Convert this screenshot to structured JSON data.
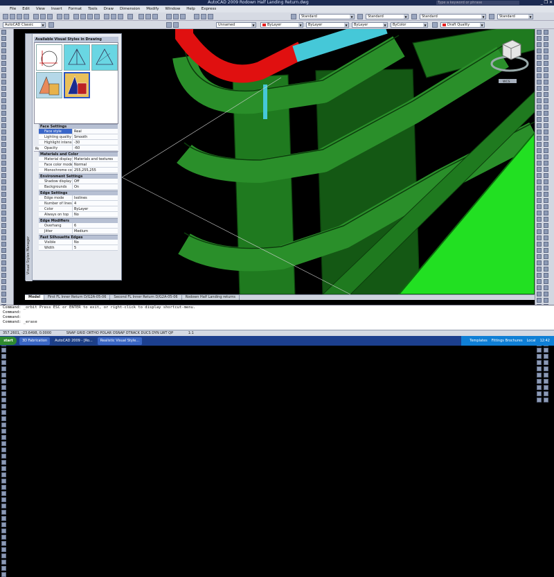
{
  "window": {
    "title": "AutoCAD 2009  Rodown Half Landing Return.dwg",
    "search_placeholder": "Type a keyword or phrase",
    "controls": "_ ❐ ✕"
  },
  "menu": [
    "File",
    "Edit",
    "View",
    "Insert",
    "Format",
    "Tools",
    "Draw",
    "Dimension",
    "Modify",
    "Window",
    "Help",
    "Express"
  ],
  "toolbar1": {
    "textstyle": "Standard",
    "dimstyle": "Standard",
    "tablestyle": "Standard",
    "mleaderstyle": "Standard"
  },
  "toolbar2": {
    "workspace": "AutoCAD Classic",
    "layer": "Unnamed",
    "color": "ByLayer",
    "linetype": "ByLayer",
    "lineweight": "ByLayer",
    "plotstyle": "ByColor",
    "render": "Draft Quality",
    "colors": {
      "layer_red": "#e62020"
    }
  },
  "viewcube": {
    "label": "WCS"
  },
  "visual_styles": {
    "header": "Available Visual Styles in Drawing",
    "current": "Realistic",
    "side_label": "Visual Styles Manager",
    "sections": [
      {
        "title": "Face Settings",
        "rows": [
          {
            "k": "Face style",
            "v": "Real",
            "selected": true
          },
          {
            "k": "Lighting quality",
            "v": "Smooth"
          },
          {
            "k": "Highlight intensity",
            "v": "-30"
          },
          {
            "k": "Opacity",
            "v": "-60"
          }
        ]
      },
      {
        "title": "Materials and Color",
        "rows": [
          {
            "k": "Material display",
            "v": "Materials and textures"
          },
          {
            "k": "Face color mode",
            "v": "Normal"
          },
          {
            "k": "Monochrome color",
            "v": "255,255,255"
          }
        ]
      },
      {
        "title": "Environment Settings",
        "rows": [
          {
            "k": "Shadow display",
            "v": "Off"
          },
          {
            "k": "Backgrounds",
            "v": "On"
          }
        ]
      },
      {
        "title": "Edge Settings",
        "rows": [
          {
            "k": "Edge mode",
            "v": "Isolines"
          },
          {
            "k": "Number of lines",
            "v": "4"
          },
          {
            "k": "Color",
            "v": "ByLayer"
          },
          {
            "k": "Always on top",
            "v": "No"
          }
        ]
      },
      {
        "title": "Edge Modifiers",
        "rows": [
          {
            "k": "Overhang",
            "v": "6"
          },
          {
            "k": "Jitter",
            "v": "Medium"
          }
        ]
      },
      {
        "title": "Fast Silhouette Edges",
        "rows": [
          {
            "k": "Visible",
            "v": "No"
          },
          {
            "k": "Width",
            "v": "5"
          }
        ]
      }
    ]
  },
  "tabs": [
    "Model",
    "First FL Inner Return D/G2A-05-06",
    "Second FL Inner Return D/G2A-05-06",
    "Rodown Half Landing returns"
  ],
  "command_lines": [
    "Command: _orbit  Press ESC or ENTER to exit, or right-click to display shortcut-menu.",
    "Command:",
    "Command:",
    "Command: _erase"
  ],
  "status": {
    "coords": "357.2601, -23.6498, 0.0000",
    "toggles": "SNAP  GRID  ORTHO  POLAR  OSNAP  OTRACK  DUCS  DYN  LWT  QP",
    "scale": "1:1"
  },
  "taskbar": {
    "start": "start",
    "buttons": [
      {
        "label": "3D Fabrication",
        "active": false
      },
      {
        "label": "AutoCAD 2009 - [Ro...",
        "active": true
      },
      {
        "label": "Realistic Visual Style...",
        "active": false
      }
    ],
    "tray": [
      "Templates",
      "Fittings Brochures",
      "Local",
      "12:42"
    ]
  },
  "scene": {
    "colors": {
      "background": "#000000",
      "frame": "#1f7a1f",
      "frame_light": "#2aa02a",
      "pipe_red": "#e01010",
      "pipe_cyan": "#45c8d8",
      "bright_green": "#22e022"
    }
  }
}
